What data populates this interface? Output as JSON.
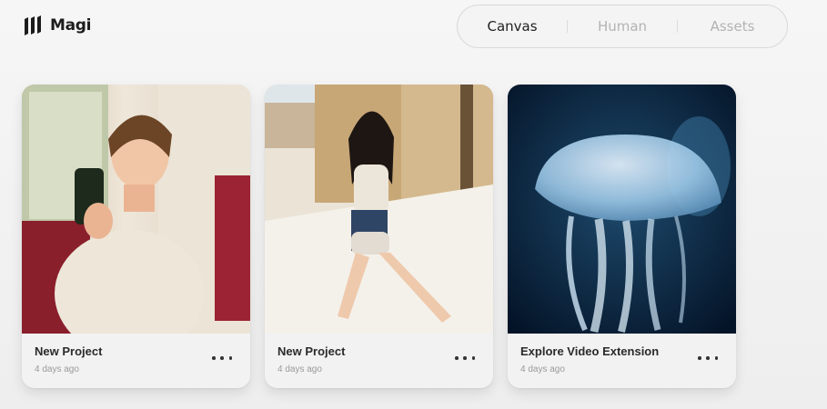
{
  "brand": {
    "name": "Magi"
  },
  "tabs": [
    {
      "label": "Canvas",
      "active": true
    },
    {
      "label": "Human",
      "active": false
    },
    {
      "label": "Assets",
      "active": false
    }
  ],
  "projects": [
    {
      "title": "New Project",
      "date": "4 days ago",
      "thumbnail": "woman-holding-phone-cafe"
    },
    {
      "title": "New Project",
      "date": "4 days ago",
      "thumbnail": "woman-walking-street"
    },
    {
      "title": "Explore Video Extension",
      "date": "4 days ago",
      "thumbnail": "jellyfish"
    }
  ],
  "icons": {
    "logo": "magi-logo-icon",
    "more": "more-options-icon"
  },
  "colors": {
    "active_tab": "#1f1f1f",
    "inactive_tab": "#b3b3b3",
    "background": "#f1f1f1"
  }
}
